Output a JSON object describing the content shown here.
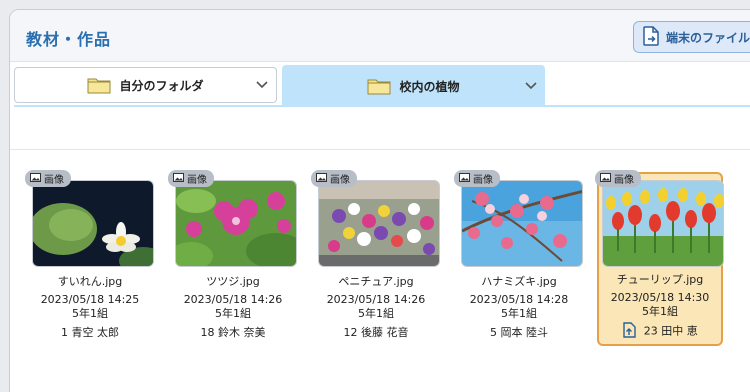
{
  "header": {
    "title": "教材・作品",
    "import_label": "端末のファイル"
  },
  "tabs": [
    {
      "label": "自分のフォルダ",
      "active": false
    },
    {
      "label": "校内の植物",
      "active": true
    }
  ],
  "colors": {
    "accent": "#2a6fb0",
    "active_tab": "#bfe3fa",
    "selected_card": "#fbe6b7",
    "selected_border": "#e7a04a"
  },
  "items": [
    {
      "badge": "画像",
      "filename": "すいれん.jpg",
      "date": "2023/05/18 14:25",
      "class": "5年1組",
      "owner": "1 青空 太郎",
      "selected": false
    },
    {
      "badge": "画像",
      "filename": "ツツジ.jpg",
      "date": "2023/05/18 14:26",
      "class": "5年1組",
      "owner": "18 鈴木 奈美",
      "selected": false
    },
    {
      "badge": "画像",
      "filename": "ペニチュア.jpg",
      "date": "2023/05/18 14:26",
      "class": "5年1組",
      "owner": "12 後藤 花音",
      "selected": false
    },
    {
      "badge": "画像",
      "filename": "ハナミズキ.jpg",
      "date": "2023/05/18 14:28",
      "class": "5年1組",
      "owner": "5 岡本 陸斗",
      "selected": false
    },
    {
      "badge": "画像",
      "filename": "チューリップ.jpg",
      "date": "2023/05/18 14:30",
      "class": "5年1組",
      "owner": "23 田中 恵",
      "selected": true
    }
  ]
}
